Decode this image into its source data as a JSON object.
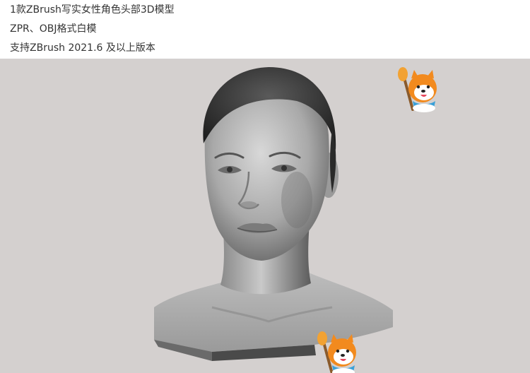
{
  "description": {
    "line1": "1款ZBrush写实女性角色头部3D模型",
    "line2": "ZPR、OBJ格式白模",
    "line3": "支持ZBrush 2021.6 及以上版本"
  },
  "preview": {
    "background_color": "#d4d0cf",
    "subject": "sculpted-female-head-bust",
    "watermark_icon": "shiba-dog-painter-icon"
  }
}
